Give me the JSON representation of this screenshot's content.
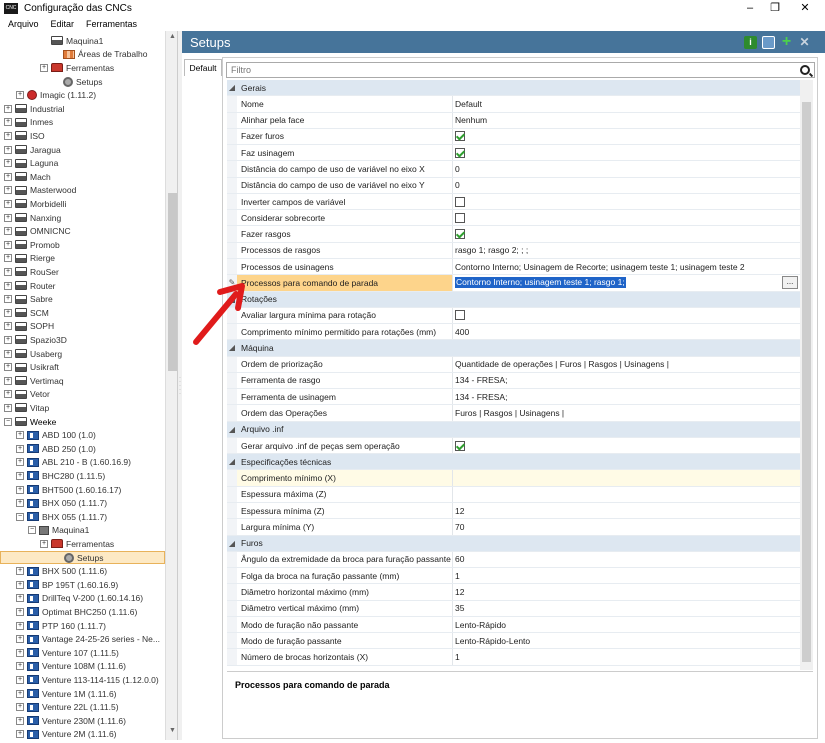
{
  "window": {
    "title": "Configuração das CNCs",
    "app_icon": "CNC",
    "controls": [
      "minimize",
      "restore",
      "close"
    ]
  },
  "menu": [
    "Arquivo",
    "Editar",
    "Ferramentas"
  ],
  "tree": [
    {
      "label": "Maquina1",
      "level": 3,
      "exp": "",
      "icon": "mach"
    },
    {
      "label": "Áreas de Trabalho",
      "level": 4,
      "exp": "",
      "icon": "areas"
    },
    {
      "label": "Ferramentas",
      "level": 3,
      "exp": "+",
      "icon": "tool"
    },
    {
      "label": "Setups",
      "level": 4,
      "exp": "",
      "icon": "gear"
    },
    {
      "label": "Imagic (1.11.2)",
      "level": 1,
      "exp": "+",
      "icon": "magic"
    },
    {
      "label": "Industrial",
      "level": 0,
      "exp": "+",
      "icon": "mach"
    },
    {
      "label": "Inmes",
      "level": 0,
      "exp": "+",
      "icon": "mach"
    },
    {
      "label": "ISO",
      "level": 0,
      "exp": "+",
      "icon": "mach"
    },
    {
      "label": "Jaragua",
      "level": 0,
      "exp": "+",
      "icon": "mach"
    },
    {
      "label": "Laguna",
      "level": 0,
      "exp": "+",
      "icon": "mach"
    },
    {
      "label": "Mach",
      "level": 0,
      "exp": "+",
      "icon": "mach"
    },
    {
      "label": "Masterwood",
      "level": 0,
      "exp": "+",
      "icon": "mach"
    },
    {
      "label": "Morbidelli",
      "level": 0,
      "exp": "+",
      "icon": "mach"
    },
    {
      "label": "Nanxing",
      "level": 0,
      "exp": "+",
      "icon": "mach"
    },
    {
      "label": "OMNICNC",
      "level": 0,
      "exp": "+",
      "icon": "mach"
    },
    {
      "label": "Promob",
      "level": 0,
      "exp": "+",
      "icon": "mach"
    },
    {
      "label": "Rierge",
      "level": 0,
      "exp": "+",
      "icon": "mach"
    },
    {
      "label": "RouSer",
      "level": 0,
      "exp": "+",
      "icon": "mach"
    },
    {
      "label": "Router",
      "level": 0,
      "exp": "+",
      "icon": "mach"
    },
    {
      "label": "Sabre",
      "level": 0,
      "exp": "+",
      "icon": "mach"
    },
    {
      "label": "SCM",
      "level": 0,
      "exp": "+",
      "icon": "mach"
    },
    {
      "label": "SOPH",
      "level": 0,
      "exp": "+",
      "icon": "mach"
    },
    {
      "label": "Spazio3D",
      "level": 0,
      "exp": "+",
      "icon": "mach"
    },
    {
      "label": "Usaberg",
      "level": 0,
      "exp": "+",
      "icon": "mach"
    },
    {
      "label": "Usikraft",
      "level": 0,
      "exp": "+",
      "icon": "mach"
    },
    {
      "label": "Vertimaq",
      "level": 0,
      "exp": "+",
      "icon": "mach"
    },
    {
      "label": "Vetor",
      "level": 0,
      "exp": "+",
      "icon": "mach"
    },
    {
      "label": "Vitap",
      "level": 0,
      "exp": "+",
      "icon": "mach"
    },
    {
      "label": "Weeke",
      "level": 0,
      "exp": "-",
      "icon": "mach"
    },
    {
      "label": "ABD 100 (1.0)",
      "level": 1,
      "exp": "+",
      "icon": "cnc"
    },
    {
      "label": "ABD 250 (1.0)",
      "level": 1,
      "exp": "+",
      "icon": "cnc"
    },
    {
      "label": "ABL 210 - B (1.60.16.9)",
      "level": 1,
      "exp": "+",
      "icon": "cnc"
    },
    {
      "label": "BHC280 (1.11.5)",
      "level": 1,
      "exp": "+",
      "icon": "cnc"
    },
    {
      "label": "BHT500 (1.60.16.17)",
      "level": 1,
      "exp": "+",
      "icon": "cnc"
    },
    {
      "label": "BHX 050 (1.11.7)",
      "level": 1,
      "exp": "+",
      "icon": "cnc"
    },
    {
      "label": "BHX 055 (1.11.7)",
      "level": 1,
      "exp": "-",
      "icon": "cnc"
    },
    {
      "label": "Maquina1",
      "level": 2,
      "exp": "-",
      "icon": "small"
    },
    {
      "label": "Ferramentas",
      "level": 3,
      "exp": "+",
      "icon": "tool"
    },
    {
      "label": "Setups",
      "level": 4,
      "exp": "",
      "icon": "gear",
      "selected": true
    },
    {
      "label": "BHX 500 (1.11.6)",
      "level": 1,
      "exp": "+",
      "icon": "cnc"
    },
    {
      "label": "BP 195T (1.60.16.9)",
      "level": 1,
      "exp": "+",
      "icon": "cnc"
    },
    {
      "label": "DrillTeq V-200 (1.60.14.16)",
      "level": 1,
      "exp": "+",
      "icon": "cnc"
    },
    {
      "label": "Optimat BHC250 (1.11.6)",
      "level": 1,
      "exp": "+",
      "icon": "cnc"
    },
    {
      "label": "PTP 160 (1.11.7)",
      "level": 1,
      "exp": "+",
      "icon": "cnc"
    },
    {
      "label": "Vantage 24-25-26 series - Ne...",
      "level": 1,
      "exp": "+",
      "icon": "cnc"
    },
    {
      "label": "Venture 107 (1.11.5)",
      "level": 1,
      "exp": "+",
      "icon": "cnc"
    },
    {
      "label": "Venture 108M (1.11.6)",
      "level": 1,
      "exp": "+",
      "icon": "cnc"
    },
    {
      "label": "Venture 113-114-115 (1.12.0.0)",
      "level": 1,
      "exp": "+",
      "icon": "cnc"
    },
    {
      "label": "Venture 1M (1.11.6)",
      "level": 1,
      "exp": "+",
      "icon": "cnc"
    },
    {
      "label": "Venture 22L (1.11.5)",
      "level": 1,
      "exp": "+",
      "icon": "cnc"
    },
    {
      "label": "Venture 230M (1.11.6)",
      "level": 1,
      "exp": "+",
      "icon": "cnc"
    },
    {
      "label": "Venture 2M (1.11.6)",
      "level": 1,
      "exp": "+",
      "icon": "cnc"
    }
  ],
  "panel": {
    "title": "Setups",
    "tab": "Default",
    "filter_placeholder": "Filtro",
    "header_icons": [
      "info-icon",
      "copy-icon",
      "add-icon",
      "delete-icon"
    ]
  },
  "grid": [
    {
      "type": "cat",
      "label": "Gerais"
    },
    {
      "type": "prop",
      "label": "Nome",
      "value": "Default"
    },
    {
      "type": "prop",
      "label": "Alinhar pela face",
      "value": "Nenhum"
    },
    {
      "type": "check",
      "label": "Fazer furos",
      "checked": true
    },
    {
      "type": "check",
      "label": "Faz usinagem",
      "checked": true
    },
    {
      "type": "prop",
      "label": "Distância do campo de uso de variável no eixo X",
      "value": "0"
    },
    {
      "type": "prop",
      "label": "Distância do campo de uso de variável no eixo Y",
      "value": "0"
    },
    {
      "type": "check",
      "label": "Inverter campos de variável",
      "checked": false
    },
    {
      "type": "check",
      "label": "Considerar sobrecorte",
      "checked": false
    },
    {
      "type": "check",
      "label": "Fazer rasgos",
      "checked": true
    },
    {
      "type": "prop",
      "label": "Processos de rasgos",
      "value": "rasgo 1; rasgo 2; ; ;"
    },
    {
      "type": "prop",
      "label": "Processos de usinagens",
      "value": "Contorno Interno; Usinagem de Recorte; usinagem teste 1; usinagem teste 2"
    },
    {
      "type": "prop",
      "label": "Processos para comando de parada",
      "value": "Contorno Interno; usinagem teste 1; rasgo 1;",
      "highlight": true,
      "edit": "..."
    },
    {
      "type": "cat",
      "label": "Rotações"
    },
    {
      "type": "check",
      "label": "Avaliar largura mínima para rotação",
      "checked": false
    },
    {
      "type": "prop",
      "label": "Comprimento mínimo permitido para rotações (mm)",
      "value": "400"
    },
    {
      "type": "cat",
      "label": "Máquina"
    },
    {
      "type": "prop",
      "label": "Ordem de priorização",
      "value": "Quantidade de operações | Furos | Rasgos | Usinagens |"
    },
    {
      "type": "prop",
      "label": "Ferramenta de rasgo",
      "value": "134 - FRESA;"
    },
    {
      "type": "prop",
      "label": "Ferramenta de usinagem",
      "value": "134 - FRESA;"
    },
    {
      "type": "prop",
      "label": "Ordem das Operações",
      "value": "Furos | Rasgos | Usinagens |"
    },
    {
      "type": "cat",
      "label": "Arquivo .inf"
    },
    {
      "type": "check",
      "label": "Gerar arquivo .inf de peças sem operação",
      "checked": true
    },
    {
      "type": "cat",
      "label": "Especificações técnicas"
    },
    {
      "type": "prop",
      "label": "Comprimento mínimo (X)",
      "value": "",
      "soft": true
    },
    {
      "type": "prop",
      "label": "Espessura máxima (Z)",
      "value": ""
    },
    {
      "type": "prop",
      "label": "Espessura mínima (Z)",
      "value": "12"
    },
    {
      "type": "prop",
      "label": "Largura mínima (Y)",
      "value": "70"
    },
    {
      "type": "cat",
      "label": "Furos"
    },
    {
      "type": "prop",
      "label": "Ângulo da extremidade da broca para furação passante",
      "value": "60"
    },
    {
      "type": "prop",
      "label": "Folga da broca na furação passante (mm)",
      "value": "1"
    },
    {
      "type": "prop",
      "label": "Diâmetro horizontal máximo (mm)",
      "value": "12"
    },
    {
      "type": "prop",
      "label": "Diâmetro vertical máximo (mm)",
      "value": "35"
    },
    {
      "type": "prop",
      "label": "Modo de furação não passante",
      "value": "Lento-Rápido"
    },
    {
      "type": "prop",
      "label": "Modo de furação passante",
      "value": "Lento-Rápido-Lento"
    },
    {
      "type": "prop",
      "label": "Número de brocas horizontais (X)",
      "value": "1"
    }
  ],
  "description": {
    "title": "Processos para comando de parada"
  },
  "colors": {
    "header": "#46749a",
    "highlight_key": "#fdd48b",
    "selection": "#1f64c8",
    "category": "#dde7f1",
    "arrow": "#e01b1b"
  }
}
